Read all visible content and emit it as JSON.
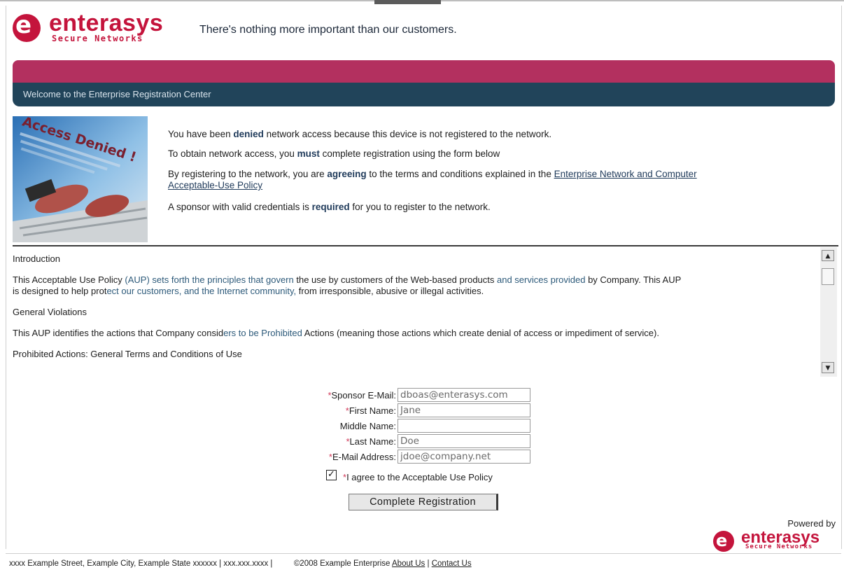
{
  "header": {
    "logo_word": "enterasys",
    "logo_sub": "Secure Networks",
    "tagline": "There's nothing more important than our customers."
  },
  "banner": {
    "title": "Welcome to the Enterprise Registration Center"
  },
  "intro": {
    "line1_pre": "You have been ",
    "line1_bold": "denied",
    "line1_post": " network access because this device is not registered to the network.",
    "line2_pre": "To obtain network access, you ",
    "line2_bold": "must",
    "line2_post": " complete registration using the form below",
    "line3_pre": "By registering to the network, you are ",
    "line3_bold": "agreeing",
    "line3_post": " to the terms and conditions explained in the ",
    "line3_link_a": "Enterprise Network and Computer",
    "line3_link_b": "Acceptable-Use Policy",
    "line4_pre": "A sponsor with valid credentials is ",
    "line4_bold": "required",
    "line4_post": " for you to register to the network.",
    "photo_text": "Access Denied !"
  },
  "aup": {
    "p1": "Introduction",
    "p2_a": "This Acceptable Use Policy ",
    "p2_b": "(AUP) sets forth the principles that govern",
    "p2_c": " the use by customers of the Web-based products ",
    "p2_d": "and services provided",
    "p2_e": " by Company. This AUP",
    "p2_f": "is designed to help prot",
    "p2_g": "ect our customers, and the Internet community,",
    "p2_h": " from irresponsible, abusive or illegal activities.",
    "p3": "General Violations",
    "p4_a": "This AUP identifies the actions that Company consid",
    "p4_b": "ers to be Prohibited",
    "p4_c": " Actions (meaning those actions which create denial of access or impediment of service).",
    "p5": "Prohibited Actions: General Terms and Conditions of Use"
  },
  "form": {
    "sponsor_label": "Sponsor E-Mail:",
    "sponsor_value": "dboas@enterasys.com",
    "first_label": "First Name:",
    "first_value": "Jane",
    "middle_label": "Middle Name:",
    "middle_value": "",
    "last_label": "Last Name:",
    "last_value": "Doe",
    "email_label": "E-Mail Address:",
    "email_value": "jdoe@company.net",
    "required_mark": "*",
    "agree_label": "I agree to the Acceptable Use Policy",
    "agree_checked": true,
    "submit_label": "Complete Registration"
  },
  "powered": {
    "label": "Powered by",
    "logo_word": "enterasys",
    "logo_sub": "Secure Networks"
  },
  "footer": {
    "address": "xxxx Example Street, Example City, Example State xxxxxx | xxx.xxx.xxxx |",
    "copyright": "©2008 Example Enterprise",
    "about_label": "About Us",
    "separator": "|",
    "contact_label": "Contact Us"
  },
  "colors": {
    "brand_red": "#c4143c",
    "band_magenta": "#b3305f",
    "band_navy": "#21445a",
    "link_navy": "#1f3a5a"
  },
  "icons": {
    "scroll_up": "triangle-up-icon",
    "scroll_down": "triangle-down-icon",
    "checkbox": "check-icon"
  }
}
